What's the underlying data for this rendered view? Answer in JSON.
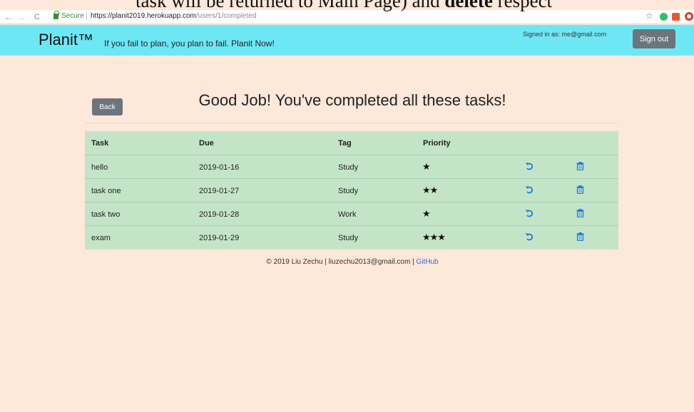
{
  "overlay": {
    "caption_plain": "task will be returned to Main Page) and ",
    "caption_bold": "delete",
    "caption_tail": " respect"
  },
  "browser": {
    "back_glyph": "←",
    "forward_glyph": "→",
    "reload_glyph": "C",
    "secure_label": "Secure",
    "url_host": "https://planit2019.herokuapp.com",
    "url_path": "/users/1/completed",
    "bookmark_glyph": "☆"
  },
  "navbar": {
    "brand": "Planit™",
    "tagline": "If you fail to plan, you plan to fail. Planit Now!",
    "signed_in": "Signed in as: me@gmail.com",
    "sign_out_label": "Sign out",
    "bg_color": "#6ee7f4"
  },
  "main": {
    "title": "Good Job! You've completed all these tasks!",
    "back_label": "Back",
    "table": {
      "headers": {
        "task": "Task",
        "due": "Due",
        "tag": "Tag",
        "priority": "Priority"
      },
      "rows": [
        {
          "task": "hello",
          "due": "2019-01-16",
          "tag": "Study",
          "priority": "★"
        },
        {
          "task": "task one",
          "due": "2019-01-27",
          "tag": "Study",
          "priority": "★★"
        },
        {
          "task": "task two",
          "due": "2019-01-28",
          "tag": "Work",
          "priority": "★"
        },
        {
          "task": "exam",
          "due": "2019-01-29",
          "tag": "Study",
          "priority": "★★★"
        }
      ],
      "row_action_icons": [
        "restore-icon",
        "trash-icon"
      ],
      "bg_color": "#c4e4c8"
    }
  },
  "footer": {
    "text": "© 2019 Liu Zechu | liuzechu2013@gmail.com | ",
    "link_label": "GitHub"
  },
  "colors": {
    "page_bg": "#fde8da",
    "button_gray": "#6c757d",
    "icon_blue": "#1e7be0"
  }
}
